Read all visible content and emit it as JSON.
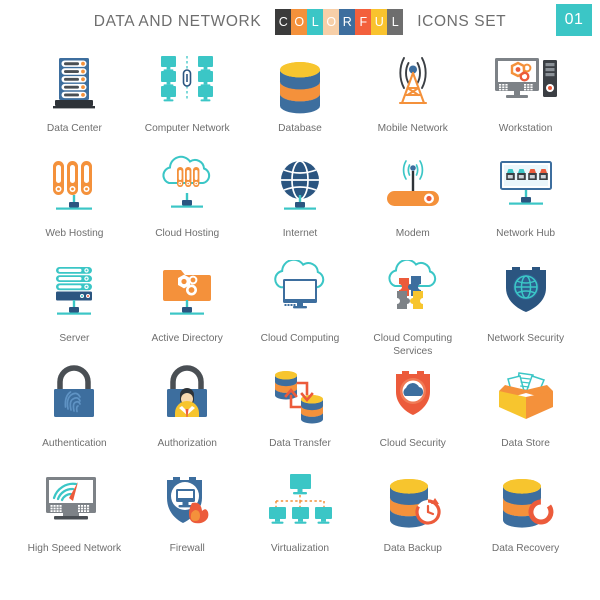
{
  "header": {
    "title_left": "DATA AND NETWORK",
    "title_right": "ICONS SET",
    "colorful_letters": [
      "C",
      "O",
      "L",
      "O",
      "R",
      "F",
      "U",
      "L"
    ],
    "colorful_colors": [
      "#3b3b3b",
      "#f4913b",
      "#3bc6c6",
      "#f7cfa8",
      "#3d6e9e",
      "#f3603c",
      "#f9c32e",
      "#6e6e6e"
    ],
    "badge_number": "01",
    "badge_color": "#3bc6c6",
    "text_color": "#6e6e6e"
  },
  "palette": {
    "teal": "#3bc6c6",
    "orange": "#f4913b",
    "blue": "#3d6e9e",
    "dark_blue": "#2b5580",
    "yellow": "#f7c52e",
    "red": "#ec5b3b",
    "gray": "#7d8287",
    "dark_gray": "#4a4f54"
  },
  "icons": [
    {
      "id": "data-center",
      "label": "Data Center"
    },
    {
      "id": "computer-network",
      "label": "Computer Network"
    },
    {
      "id": "database",
      "label": "Database"
    },
    {
      "id": "mobile-network",
      "label": "Mobile Network"
    },
    {
      "id": "workstation",
      "label": "Workstation"
    },
    {
      "id": "web-hosting",
      "label": "Web Hosting"
    },
    {
      "id": "cloud-hosting",
      "label": "Cloud Hosting"
    },
    {
      "id": "internet",
      "label": "Internet"
    },
    {
      "id": "modem",
      "label": "Modem"
    },
    {
      "id": "network-hub",
      "label": "Network Hub"
    },
    {
      "id": "server",
      "label": "Server"
    },
    {
      "id": "active-directory",
      "label": "Active Directory"
    },
    {
      "id": "cloud-computing",
      "label": "Cloud Computing"
    },
    {
      "id": "cloud-computing-services",
      "label": "Cloud Computing Services"
    },
    {
      "id": "network-security",
      "label": "Network Security"
    },
    {
      "id": "authentication",
      "label": "Authentication"
    },
    {
      "id": "authorization",
      "label": "Authorization"
    },
    {
      "id": "data-transfer",
      "label": "Data Transfer"
    },
    {
      "id": "cloud-security",
      "label": "Cloud Security"
    },
    {
      "id": "data-store",
      "label": "Data Store"
    },
    {
      "id": "high-speed-network",
      "label": "High Speed Network"
    },
    {
      "id": "firewall",
      "label": "Firewall"
    },
    {
      "id": "virtualization",
      "label": "Virtualization"
    },
    {
      "id": "data-backup",
      "label": "Data Backup"
    },
    {
      "id": "data-recovery",
      "label": "Data Recovery"
    }
  ]
}
